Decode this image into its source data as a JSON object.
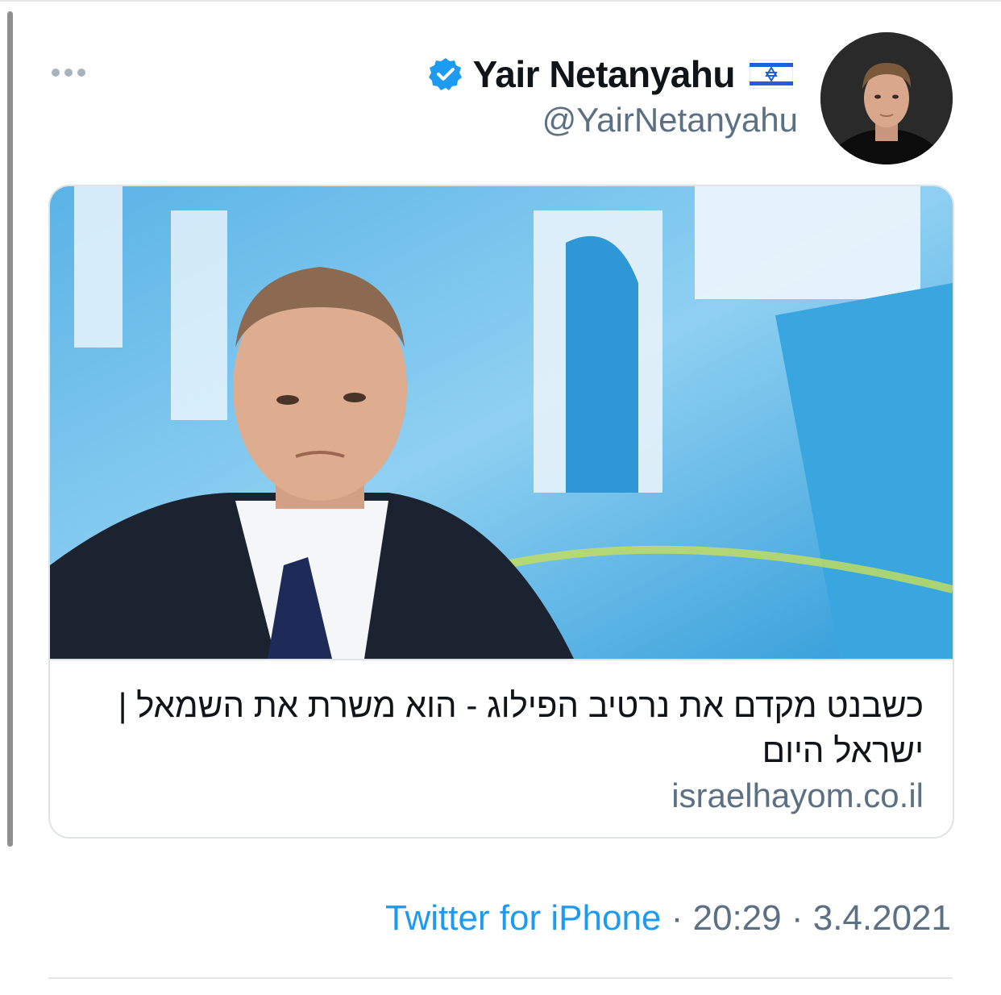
{
  "tweet": {
    "author_name": "Yair Netanyahu",
    "author_handle": "@YairNetanyahu",
    "icons": [
      "more-icon",
      "verified-icon",
      "israel-flag-icon",
      "avatar-photo"
    ],
    "card": {
      "title": "כשבנט מקדם את נרטיב הפילוג - הוא משרת את השמאל | ישראל היום",
      "domain": "israelhayom.co.il"
    },
    "meta": {
      "source": "Twitter for iPhone",
      "separator": " · ",
      "time": "20:29",
      "date": "3.4.2021"
    },
    "colors": {
      "link": "#1d9bf0",
      "secondary_text": "#5b7083",
      "verified": "#1d9bf0"
    }
  }
}
